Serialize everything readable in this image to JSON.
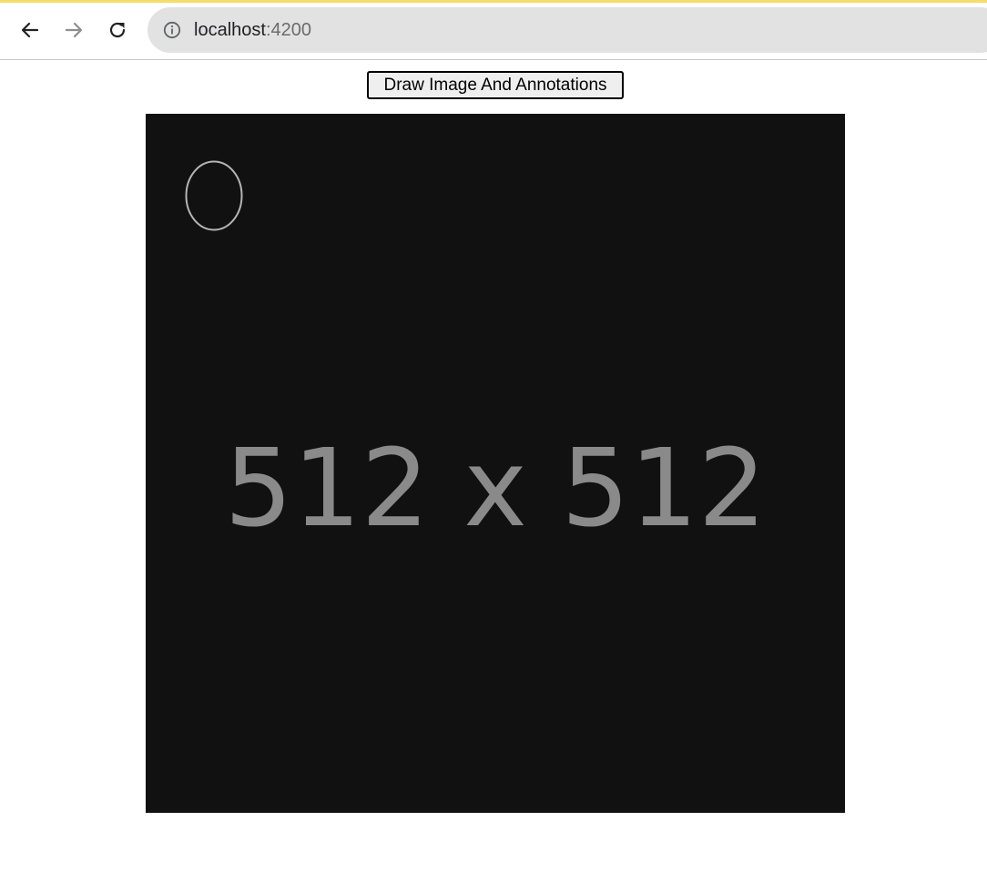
{
  "browser": {
    "address_host": "localhost",
    "address_port": ":4200",
    "icons": {
      "back": "arrow-left-icon",
      "forward": "arrow-right-icon",
      "reload": "reload-icon",
      "site_info": "info-circle-icon"
    }
  },
  "page": {
    "draw_button_label": "Draw Image And Annotations",
    "canvas": {
      "placeholder_text": "512 x 512",
      "background_color": "#111111",
      "text_color": "#8a8a8a",
      "annotation": {
        "shape": "ellipse",
        "stroke_color": "#b5b5b5"
      }
    }
  },
  "colors": {
    "toolbar_accent": "#f5dd6a",
    "omnibox_bg": "#e2e2e2"
  }
}
